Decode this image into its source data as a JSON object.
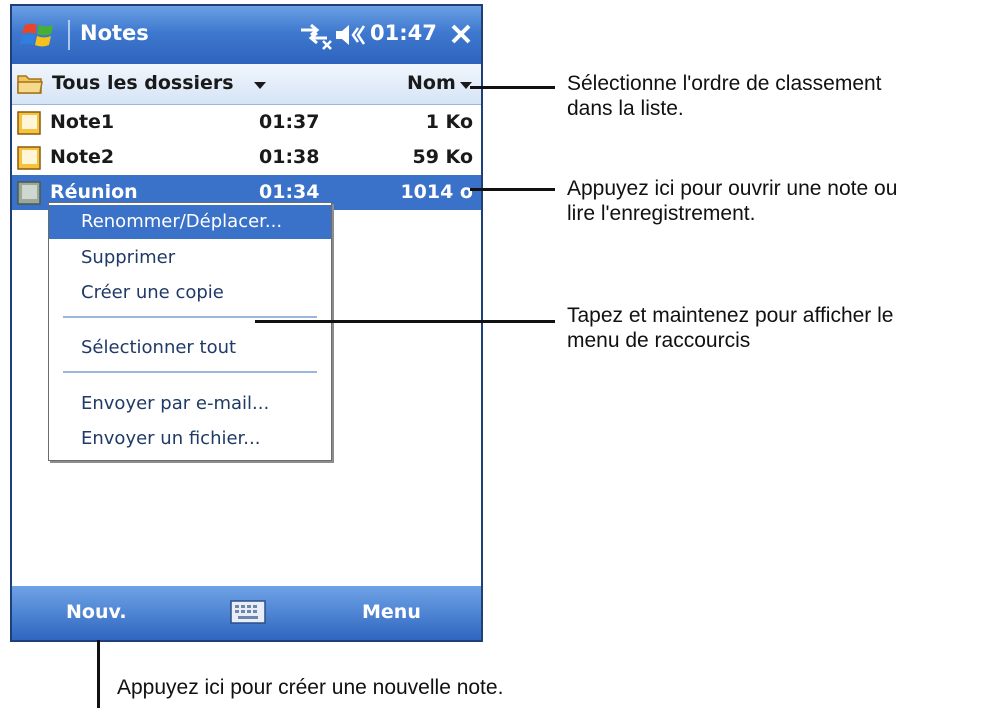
{
  "titlebar": {
    "app_title": "Notes",
    "clock": "01:47"
  },
  "toolbar": {
    "folder": "Tous les dossiers",
    "sort": "Nom"
  },
  "notes": [
    {
      "name": "Note1",
      "time": "01:37",
      "size": "1 Ko"
    },
    {
      "name": "Note2",
      "time": "01:38",
      "size": "59 Ko"
    },
    {
      "name": "Réunion",
      "time": "01:34",
      "size": "1014 o"
    }
  ],
  "context_menu": {
    "items": [
      "Renommer/Déplacer...",
      "Supprimer",
      "Créer une copie",
      "Sélectionner tout",
      "Envoyer par e-mail...",
      "Envoyer un fichier..."
    ]
  },
  "bottombar": {
    "new_label": "Nouv.",
    "menu_label": "Menu"
  },
  "callouts": {
    "sort_line1": "Sélectionne l'ordre de classement",
    "sort_line2": "dans la liste.",
    "open_line1": "Appuyez ici pour ouvrir une note ou",
    "open_line2": "lire l'enregistrement.",
    "menu_line1": "Tapez et maintenez pour afficher le",
    "menu_line2": "menu de raccourcis",
    "new_note": "Appuyez ici pour créer une nouvelle note."
  },
  "colors": {
    "titlebar": "#3f79cf",
    "selection": "#3a72c9",
    "menu_text": "#1f3a66"
  },
  "icons": [
    "windows-start-icon",
    "connectivity-icon",
    "volume-icon",
    "close-icon",
    "folder-icon",
    "note-icon",
    "voice-note-icon",
    "keyboard-icon"
  ]
}
